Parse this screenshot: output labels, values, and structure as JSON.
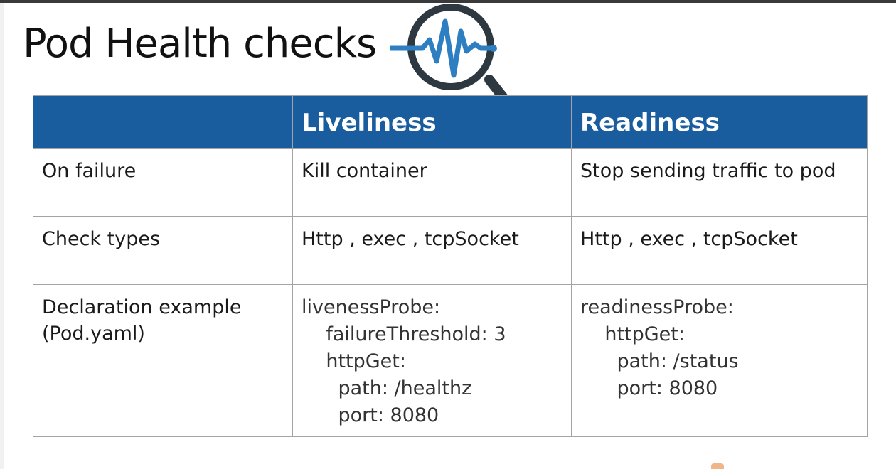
{
  "title": "Pod Health checks",
  "icon": "magnifier-heartbeat-icon",
  "colors": {
    "header_bg": "#1a5d9f",
    "header_text": "#ffffff",
    "icon_dark": "#2d3840",
    "icon_accent": "#2e7fc1"
  },
  "table": {
    "headers": [
      "",
      "Liveliness",
      "Readiness"
    ],
    "rows": [
      {
        "label": "On failure",
        "liveliness": "Kill container",
        "readiness": "Stop sending traffic to pod"
      },
      {
        "label": "Check types",
        "liveliness": "Http , exec , tcpSocket",
        "readiness": "Http , exec , tcpSocket"
      },
      {
        "label": "Declaration example\n(Pod.yaml)",
        "liveliness": "livenessProbe:\n    failureThreshold: 3\n    httpGet:\n      path: /healthz\n      port: 8080",
        "readiness": "readinessProbe:\n    httpGet:\n      path: /status\n      port: 8080"
      }
    ]
  }
}
